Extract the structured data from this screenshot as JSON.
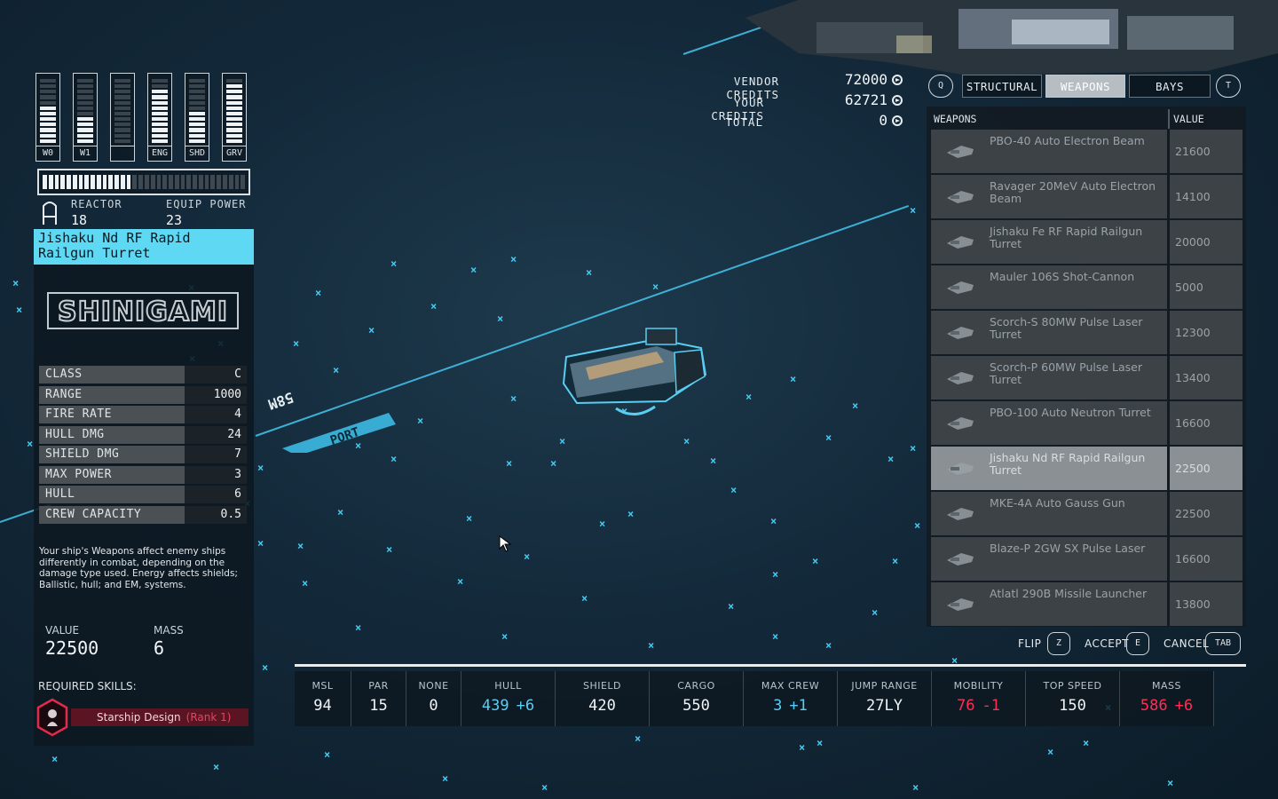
{
  "power": [
    {
      "label": "W0",
      "level": 0.6
    },
    {
      "label": "W1",
      "level": 0.4
    },
    {
      "label": "",
      "level": 0
    },
    {
      "label": "ENG",
      "level": 0.85
    },
    {
      "label": "SHD",
      "level": 0.5
    },
    {
      "label": "GRV",
      "level": 0.95
    }
  ],
  "reactor": {
    "label": "REACTOR",
    "value": "18",
    "equip_label": "EQUIP POWER",
    "equip_value": "23",
    "usage": 0.43
  },
  "item": {
    "title": "Jishaku Nd RF Rapid Railgun Turret",
    "brand": "SHINIGAMI",
    "stats": [
      {
        "key": "CLASS",
        "value": "C"
      },
      {
        "key": "RANGE",
        "value": "1000"
      },
      {
        "key": "FIRE RATE",
        "value": "4"
      },
      {
        "key": "HULL DMG",
        "value": "24"
      },
      {
        "key": "SHIELD DMG",
        "value": "7"
      },
      {
        "key": "MAX POWER",
        "value": "3"
      },
      {
        "key": "HULL",
        "value": "6"
      },
      {
        "key": "CREW CAPACITY",
        "value": "0.5"
      }
    ],
    "description": "Your ship's Weapons affect enemy ships differently in combat, depending on the damage type used. Energy affects shields; Ballistic, hull; and EM, systems.",
    "value_label": "VALUE",
    "value": "22500",
    "mass_label": "MASS",
    "mass": "6",
    "required_label": "REQUIRED SKILLS:",
    "skill_name": "Starship Design",
    "skill_rank": "(Rank 1)"
  },
  "credits": {
    "vendor_label": "VENDOR CREDITS",
    "vendor_value": "72000",
    "your_label": "YOUR CREDITS",
    "your_value": "62721",
    "total_label": "TOTAL",
    "total_value": "0"
  },
  "tabs": {
    "left_key": "Q",
    "right_key": "T",
    "items": [
      "STRUCTURAL",
      "WEAPONS",
      "BAYS"
    ],
    "active": "WEAPONS"
  },
  "weapons_list": {
    "header_name": "WEAPONS",
    "header_value": "VALUE",
    "rows": [
      {
        "name": "PBO-40 Auto Electron Beam",
        "value": "21600"
      },
      {
        "name": "Ravager 20MeV Auto Electron Beam",
        "value": "14100"
      },
      {
        "name": "Jishaku Fe RF Rapid Railgun Turret",
        "value": "20000"
      },
      {
        "name": "Mauler 106S Shot-Cannon",
        "value": "5000"
      },
      {
        "name": "Scorch-S 80MW Pulse Laser Turret",
        "value": "12300"
      },
      {
        "name": "Scorch-P 60MW Pulse Laser Turret",
        "value": "13400"
      },
      {
        "name": "PBO-100 Auto Neutron Turret",
        "value": "16600"
      },
      {
        "name": "Jishaku Nd RF Rapid Railgun Turret",
        "value": "22500",
        "selected": true
      },
      {
        "name": "MKE-4A Auto Gauss Gun",
        "value": "22500"
      },
      {
        "name": "Blaze-P 2GW SX Pulse Laser",
        "value": "16600"
      },
      {
        "name": "Atlatl 290B Missile Launcher",
        "value": "13800"
      }
    ]
  },
  "actions": {
    "flip": "FLIP",
    "flip_key": "Z",
    "accept": "ACCEPT",
    "accept_key": "E",
    "cancel": "CANCEL",
    "cancel_key": "TAB"
  },
  "ship_stats": [
    {
      "label": "MSL",
      "value": "94"
    },
    {
      "label": "PAR",
      "value": "15"
    },
    {
      "label": "NONE",
      "value": "0"
    },
    {
      "label": "HULL",
      "value": "439",
      "delta": "+6",
      "color": "blue"
    },
    {
      "label": "SHIELD",
      "value": "420"
    },
    {
      "label": "CARGO",
      "value": "550"
    },
    {
      "label": "MAX CREW",
      "value": "3",
      "delta": "+1",
      "color": "blue"
    },
    {
      "label": "JUMP RANGE",
      "value": "27LY"
    },
    {
      "label": "MOBILITY",
      "value": "76",
      "delta": "-1",
      "color": "red"
    },
    {
      "label": "TOP SPEED",
      "value": "150"
    },
    {
      "label": "MASS",
      "value": "586",
      "delta": "+6",
      "color": "red"
    }
  ],
  "viewport": {
    "port_label": "PORT",
    "distance_label": "58M"
  },
  "colors": {
    "accent": "#5fd8f4",
    "grid": "#46c6ee",
    "negative": "#ff2e55",
    "skill": "#5a1422"
  }
}
